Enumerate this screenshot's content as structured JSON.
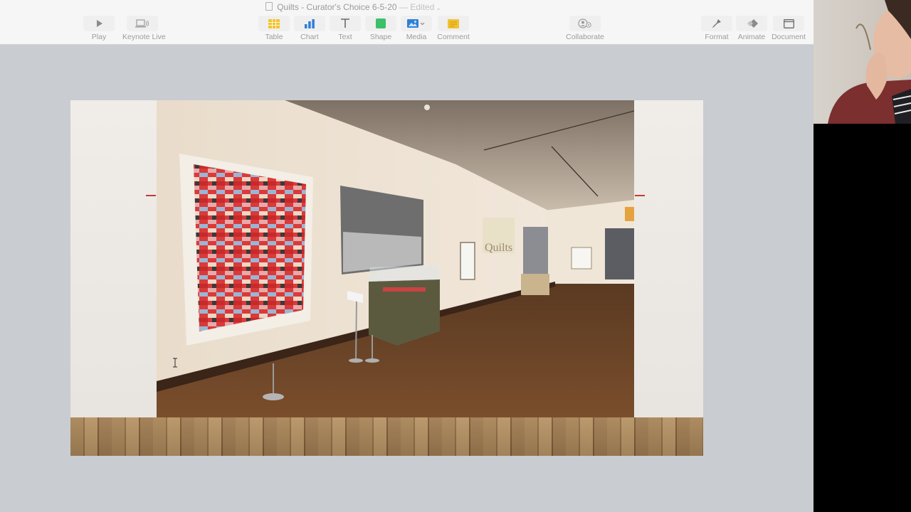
{
  "window": {
    "doc_title": "Quilts - Curator's Choice 6-5-20",
    "status": "— Edited"
  },
  "toolbar": {
    "play": "Play",
    "keynote_live": "Keynote Live",
    "table": "Table",
    "chart": "Chart",
    "text": "Text",
    "shape": "Shape",
    "media": "Media",
    "comment": "Comment",
    "collaborate": "Collaborate",
    "format": "Format",
    "animate": "Animate",
    "document": "Document"
  },
  "photo": {
    "signage_text": "Quilts"
  },
  "colors": {
    "toolbar_bg": "#f6f6f6",
    "canvas_bg": "#c9ccd1",
    "quilt_red": "#d93a3a",
    "accent_yellow": "#f2c230",
    "accent_blue": "#2f7fd8",
    "accent_green": "#3cc06a"
  }
}
